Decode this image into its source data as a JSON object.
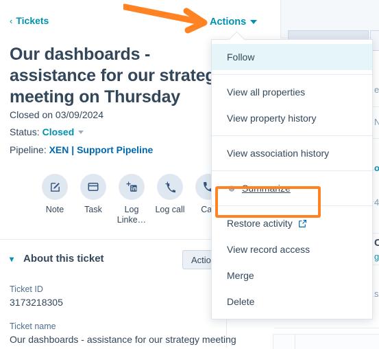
{
  "breadcrumb": {
    "icon": "chevron-left-icon",
    "label": "Tickets"
  },
  "record": {
    "title": "Our dashboards - assistance for our strategy meeting on Thursday",
    "closed_on": "Closed on 03/09/2024",
    "status_label": "Status:",
    "status_value": "Closed",
    "pipeline_label": "Pipeline:",
    "pipeline_value": "XEN | Support Pipeline"
  },
  "quick_actions": [
    {
      "icon": "note-pencil-icon",
      "label": "Note"
    },
    {
      "icon": "task-window-icon",
      "label": "Task"
    },
    {
      "icon": "log-linkedin-icon",
      "label": "Log Linke…"
    },
    {
      "icon": "log-call-icon",
      "label": "Log call"
    },
    {
      "icon": "call-phone-icon",
      "label": "Call"
    }
  ],
  "actions_trigger": {
    "label": "Actions",
    "icon": "caret-down-icon"
  },
  "actions_menu": {
    "groups": [
      {
        "items": [
          {
            "label": "Follow",
            "highlighted": true
          }
        ]
      },
      {
        "items": [
          {
            "label": "View all properties"
          },
          {
            "label": "View property history"
          }
        ]
      },
      {
        "items": [
          {
            "label": "View association history"
          }
        ]
      },
      {
        "items": [
          {
            "label": "Summarize",
            "icon": "ai-summarize-icon",
            "underlined": true,
            "highlighted_box": true
          }
        ]
      },
      {
        "items": [
          {
            "label": "Restore activity",
            "icon": "external-link-icon"
          },
          {
            "label": "View record access"
          },
          {
            "label": "Merge"
          },
          {
            "label": "Delete"
          }
        ]
      }
    ]
  },
  "about_card": {
    "chevron": "chevron-down-icon",
    "title": "About this ticket",
    "actions_button": "Actions",
    "fields": [
      {
        "label": "Ticket ID",
        "value": "3173218305"
      },
      {
        "label": "Ticket name",
        "value": "Our dashboards - assistance for our strategy meeting"
      }
    ]
  },
  "annotation": {
    "arrow_color": "#ff8322",
    "highlight_color": "#ff8322"
  },
  "background_fragments": [
    "e",
    "N",
    "o",
    "4",
    "C",
    "g",
    "s,"
  ]
}
